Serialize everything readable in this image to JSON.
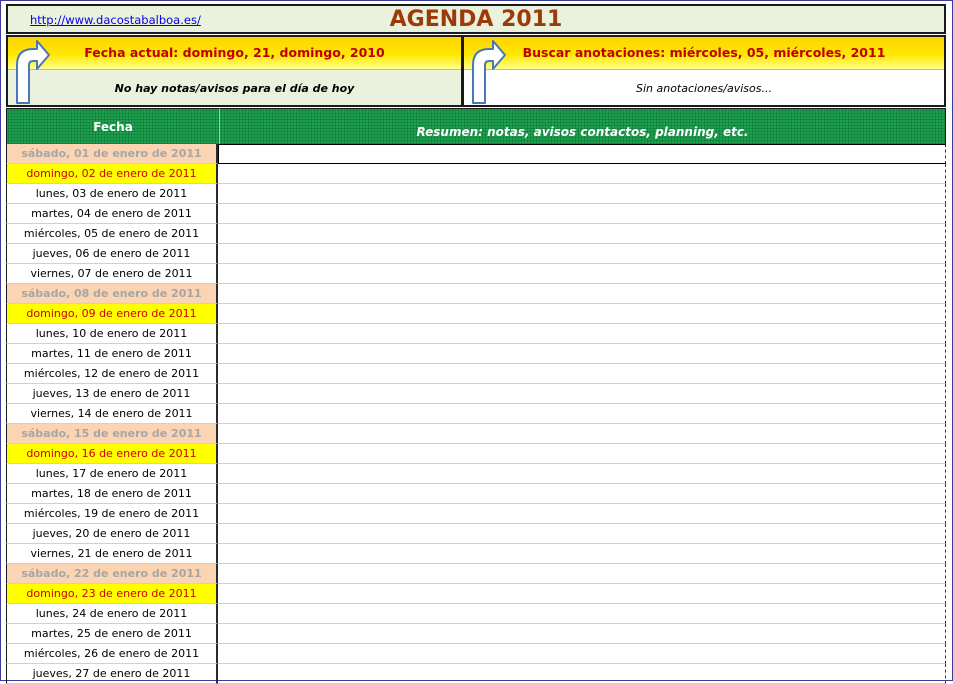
{
  "header": {
    "link": "http://www.dacostabalboa.es/",
    "title": "AGENDA 2011"
  },
  "panel_left": {
    "label": "Fecha actual:  domingo, 21, domingo, 2010",
    "message": "No hay notas/avisos  para el día de hoy",
    "icon": "curved-arrow-icon"
  },
  "panel_right": {
    "label": "Buscar anotaciones:  miércoles, 05, miércoles, 2011",
    "message": "Sin anotaciones/avisos...",
    "icon": "curved-arrow-icon"
  },
  "table": {
    "col_date": "Fecha",
    "col_summary": "Resumen: notas, avisos contactos, planning, etc.",
    "rows": [
      {
        "date": "sábado, 01 de enero de 2011",
        "type": "sat"
      },
      {
        "date": "domingo, 02 de enero de 2011",
        "type": "sun"
      },
      {
        "date": "lunes, 03 de enero de 2011",
        "type": "day"
      },
      {
        "date": "martes, 04 de enero de 2011",
        "type": "day"
      },
      {
        "date": "miércoles, 05 de enero de 2011",
        "type": "day"
      },
      {
        "date": "jueves, 06 de enero de 2011",
        "type": "day"
      },
      {
        "date": "viernes, 07 de enero de 2011",
        "type": "day"
      },
      {
        "date": "sábado, 08 de enero de 2011",
        "type": "sat"
      },
      {
        "date": "domingo, 09 de enero de 2011",
        "type": "sun"
      },
      {
        "date": "lunes, 10 de enero de 2011",
        "type": "day"
      },
      {
        "date": "martes, 11 de enero de 2011",
        "type": "day"
      },
      {
        "date": "miércoles, 12 de enero de 2011",
        "type": "day"
      },
      {
        "date": "jueves, 13 de enero de 2011",
        "type": "day"
      },
      {
        "date": "viernes, 14 de enero de 2011",
        "type": "day"
      },
      {
        "date": "sábado, 15 de enero de 2011",
        "type": "sat"
      },
      {
        "date": "domingo, 16 de enero de 2011",
        "type": "sun"
      },
      {
        "date": "lunes, 17 de enero de 2011",
        "type": "day"
      },
      {
        "date": "martes, 18 de enero de 2011",
        "type": "day"
      },
      {
        "date": "miércoles, 19 de enero de 2011",
        "type": "day"
      },
      {
        "date": "jueves, 20 de enero de 2011",
        "type": "day"
      },
      {
        "date": "viernes, 21 de enero de 2011",
        "type": "day"
      },
      {
        "date": "sábado, 22 de enero de 2011",
        "type": "sat"
      },
      {
        "date": "domingo, 23 de enero de 2011",
        "type": "sun"
      },
      {
        "date": "lunes, 24 de enero de 2011",
        "type": "day"
      },
      {
        "date": "martes, 25 de enero de 2011",
        "type": "day"
      },
      {
        "date": "miércoles, 26 de enero de 2011",
        "type": "day"
      },
      {
        "date": "jueves, 27 de enero de 2011",
        "type": "day"
      }
    ]
  },
  "colors": {
    "title": "#9c3a0a",
    "header_green": "#1fa050",
    "saturday_bg": "#fbd4b4",
    "sunday_bg": "#ffff00",
    "sunday_text": "#d00000",
    "panel_text": "#c00000"
  }
}
